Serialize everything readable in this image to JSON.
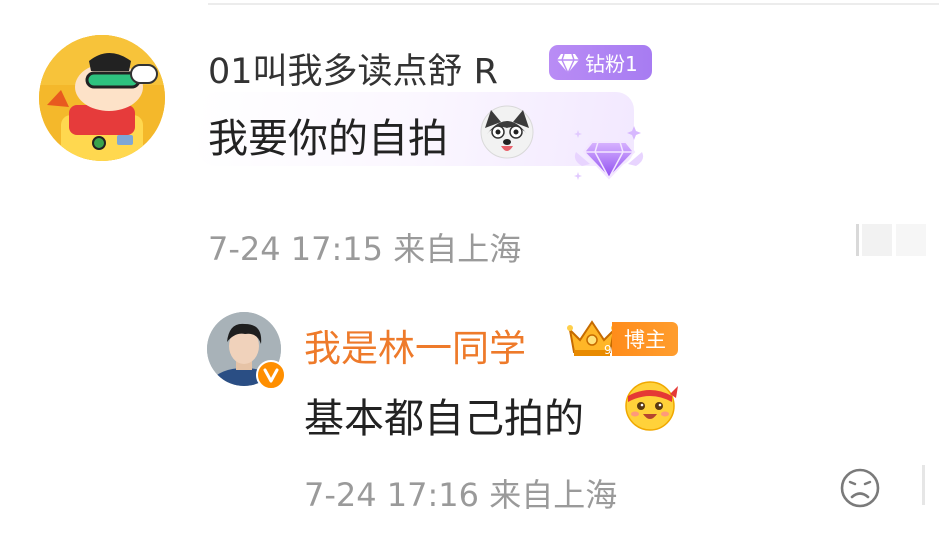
{
  "comment": {
    "username": "01叫我多读点舒 R",
    "fan_badge": "钻粉1",
    "text": "我要你的自拍",
    "date": "7-24",
    "time": "17:15",
    "location": "来自上海",
    "emoji": "husky-emoji"
  },
  "reply": {
    "username": "我是林一同学",
    "badge": "博主",
    "text": "基本都自己拍的",
    "date": "7-24",
    "time": "17:16",
    "location": "来自上海",
    "emoji": "headband-smile-emoji"
  },
  "icons": [
    "diamond-icon",
    "crown-icon",
    "verified-icon",
    "dislike-icon"
  ],
  "colors": {
    "reply_username": "#ee7a2a",
    "fan_badge": "#b98cf5",
    "blogger_badge": "#ff8c1a",
    "meta_text": "#9a9a9a"
  }
}
